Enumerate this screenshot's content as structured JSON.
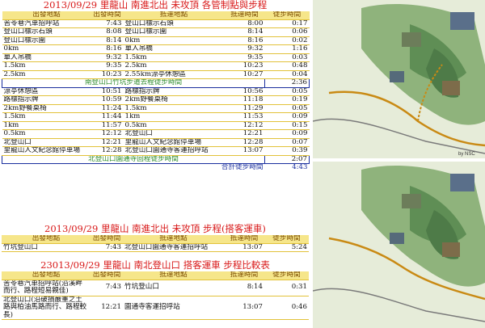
{
  "title1": "2013/09/29 里龍山 南進北出 未攻頂 各管制點與步程",
  "headers": [
    "出發地點",
    "出發時間",
    "抵達地點",
    "抵達時間",
    "徒步時間"
  ],
  "rows1": [
    [
      "苦苓巷汽車招呼站",
      "7:43",
      "登山口標示石頭",
      "8:00",
      "0:17"
    ],
    [
      "登山口標示石頭",
      "8:08",
      "登山口標示圍",
      "8:14",
      "0:06"
    ],
    [
      "登山口標示圍",
      "8:14",
      "0km",
      "8:16",
      "0:02"
    ],
    [
      "0km",
      "8:16",
      "單人吊橋",
      "9:32",
      "1:16"
    ],
    [
      "單人吊橋",
      "9:32",
      "1.5km",
      "9:35",
      "0:03"
    ],
    [
      "1.5km",
      "9:35",
      "2.5km",
      "10:23",
      "0:48"
    ],
    [
      "2.5km",
      "10:23",
      "2.55km涼亭休憩區",
      "10:27",
      "0:04"
    ]
  ],
  "note1": "南登山口竹坑步道去程徒步時間",
  "note1_time": "2:36",
  "rows2": [
    [
      "涼亭休憩區",
      "10:51",
      "路標指示牌",
      "10:56",
      "0:05"
    ],
    [
      "路標指示牌",
      "10:59",
      "2km野餐桌椅",
      "11:18",
      "0:19"
    ],
    [
      "2km野餐桌椅",
      "11:24",
      "1.5km",
      "11:29",
      "0:05"
    ],
    [
      "1.5km",
      "11:44",
      "1km",
      "11:53",
      "0:09"
    ],
    [
      "1km",
      "11:57",
      "0.5km",
      "12:12",
      "0:15"
    ],
    [
      "0.5km",
      "12:12",
      "北登山口",
      "12:21",
      "0:09"
    ],
    [
      "北登山口",
      "12:21",
      "里龍山人文紀念館停車場",
      "12:28",
      "0:07"
    ],
    [
      "里龍山人文紀念館停車場",
      "12:28",
      "北登山口園通寺客運招呼站",
      "13:07",
      "0:39"
    ]
  ],
  "note2": "北登山口園通寺回程徒步時間",
  "note2_time": "2:07",
  "total_label": "合計徒步時間",
  "total_time": "4:43",
  "title2": "2013/09/29 里龍山 南進北出 未攻頂 步程(搭客運車)",
  "rows3": [
    [
      "竹坑登山口",
      "7:43",
      "北登山口園通寺客運招呼站",
      "13:07",
      "5:24"
    ]
  ],
  "title3": "23013/09/29 里龍山 南北登山口 搭客運車 步程比較表",
  "rows4": [
    [
      "苦苓巷汽車招呼站(沿溪畔而行、路程短易親佳)",
      "7:43",
      "竹坑登山口",
      "8:14",
      "0:31"
    ],
    [
      "北登山口(沿破損嚴重之土路與柏油馬路而行、路程較長)",
      "12:21",
      "園通寺客運招呼站",
      "13:07",
      "0:46"
    ]
  ],
  "map_credit": "by NSC",
  "colors": {
    "title": "#d81818",
    "header_bg": "#f6e68a",
    "note_border": "#1a2f9e",
    "note_text": "#2a8a2a",
    "route": "#c98a14"
  }
}
